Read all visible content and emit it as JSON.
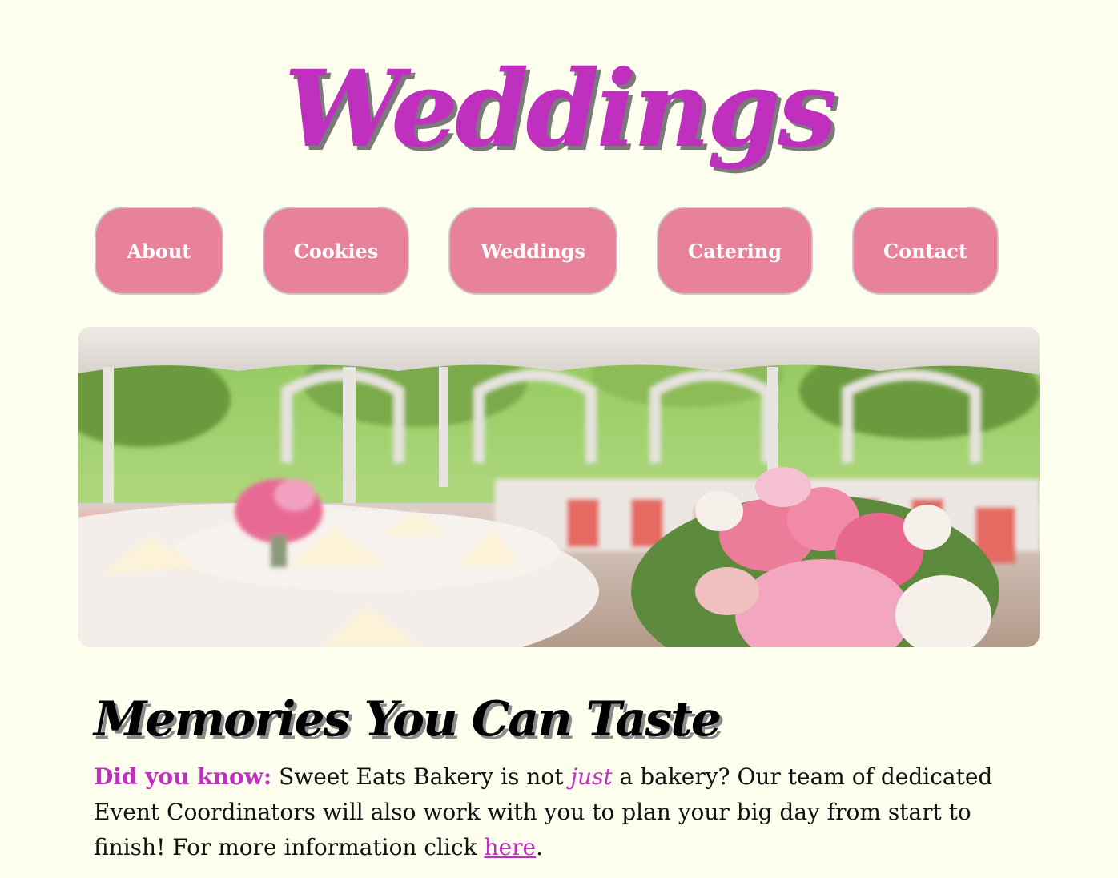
{
  "header": {
    "title": "Weddings"
  },
  "nav": {
    "items": [
      {
        "label": "About"
      },
      {
        "label": "Cookies"
      },
      {
        "label": "Weddings"
      },
      {
        "label": "Catering"
      },
      {
        "label": "Contact"
      }
    ]
  },
  "hero": {
    "image": "wedding-tent-reception-photo"
  },
  "main": {
    "heading": "Memories You Can Taste",
    "intro_label": "Did you know:",
    "text_1": " Sweet Eats Bakery is not ",
    "emphasis": "just",
    "text_2": " a bakery? Our team of dedicated Event Coordinators will also work with you to plan your big day from start to finish! For more information click ",
    "link_label": "here",
    "text_end": "."
  },
  "colors": {
    "background": "#fefeee",
    "accent": "#c030be",
    "nav_button": "#e8829b"
  }
}
